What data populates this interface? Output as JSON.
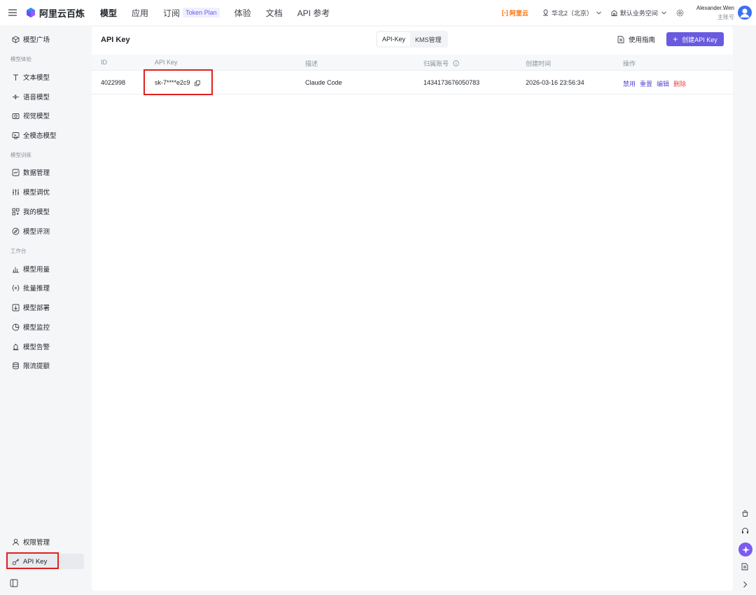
{
  "topbar": {
    "logo_text": "阿里云百炼",
    "nav": [
      {
        "label": "模型",
        "active": true
      },
      {
        "label": "应用"
      },
      {
        "label": "订阅",
        "badge": "Token Plan"
      },
      {
        "label": "体验"
      },
      {
        "label": "文档"
      },
      {
        "label": "API 参考"
      }
    ],
    "brand": "阿里云",
    "brand_mark": "[-]",
    "region": "华北2（北京）",
    "workspace": "默认业务空间",
    "user_name": "Alexander.Wen",
    "user_role": "主账号"
  },
  "sidebar": {
    "top_item": "模型广场",
    "sections": {
      "experience": "模型体验",
      "training": "模型训练",
      "workbench": "工作台"
    },
    "experience_items": [
      "文本模型",
      "语音模型",
      "视觉模型",
      "全模态模型"
    ],
    "training_items": [
      "数据管理",
      "模型调优",
      "我的模型",
      "模型评测"
    ],
    "workbench_items": [
      "模型用量",
      "批量推理",
      "模型部署",
      "模型监控",
      "模型告警",
      "限流提额"
    ],
    "bottom_items": [
      "权限管理",
      "API Key"
    ]
  },
  "main": {
    "title": "API Key",
    "tabs": [
      {
        "label": "API-Key",
        "active": true
      },
      {
        "label": "KMS管理"
      }
    ],
    "guide_label": "使用指南",
    "create_label": "创建API Key",
    "columns": [
      "ID",
      "API Key",
      "描述",
      "归属账号",
      "创建时间",
      "操作"
    ],
    "rows": [
      {
        "id": "4022998",
        "key": "sk-7****e2c9",
        "desc": "Claude Code",
        "account": "1434173676050783",
        "created": "2026-03-16 23:56:34",
        "actions": [
          "禁用",
          "重置",
          "编辑",
          "删除"
        ]
      }
    ]
  },
  "colors": {
    "accent": "#6a5ae0",
    "danger": "#e5484d",
    "highlight": "#e02020"
  }
}
